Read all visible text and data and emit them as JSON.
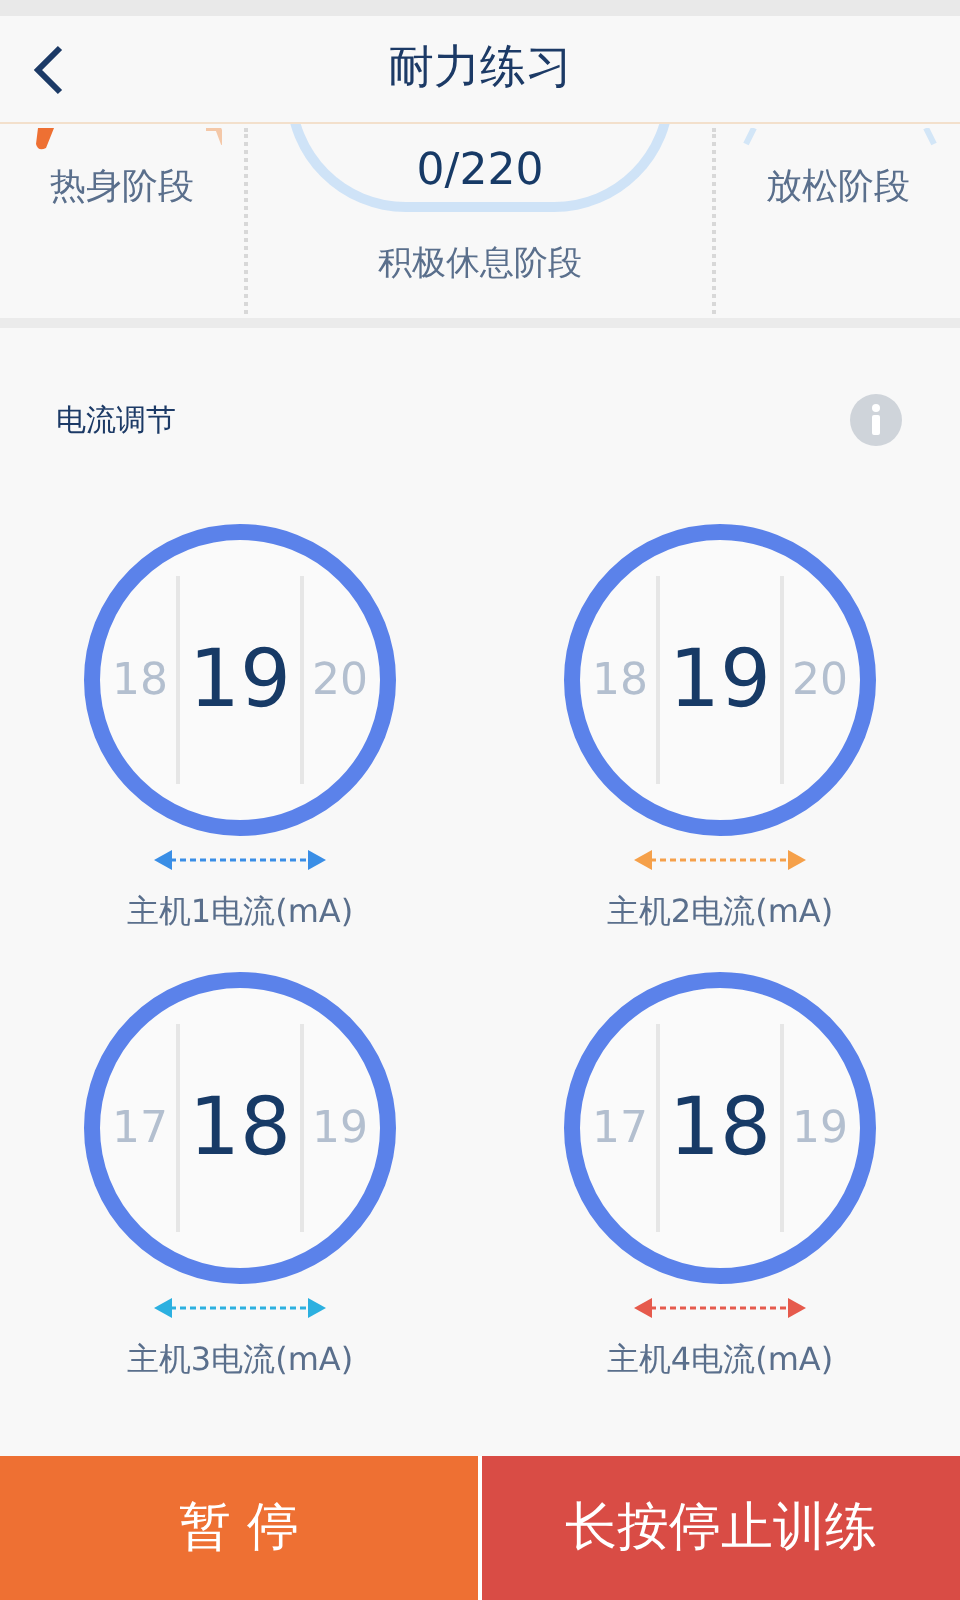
{
  "header": {
    "title": "耐力练习"
  },
  "stages": {
    "warmup": "热身阶段",
    "cycle_count": "0/220",
    "active_rest": "积极休息阶段",
    "cooldown": "放松阶段"
  },
  "current_adjust": {
    "title": "电流调节",
    "dials": [
      {
        "previous": "18",
        "value": "19",
        "next": "20",
        "label": "主机1电流(mA)",
        "color": "#3a8ee6"
      },
      {
        "previous": "18",
        "value": "19",
        "next": "20",
        "label": "主机2电流(mA)",
        "color": "#f5a04a"
      },
      {
        "previous": "17",
        "value": "18",
        "next": "19",
        "label": "主机3电流(mA)",
        "color": "#2cb0e0"
      },
      {
        "previous": "17",
        "value": "18",
        "next": "19",
        "label": "主机4电流(mA)",
        "color": "#e65a4c"
      }
    ]
  },
  "buttons": [
    {
      "label": "暂 停",
      "kind": "pause"
    },
    {
      "label": "长按停止训练",
      "kind": "stop"
    }
  ]
}
